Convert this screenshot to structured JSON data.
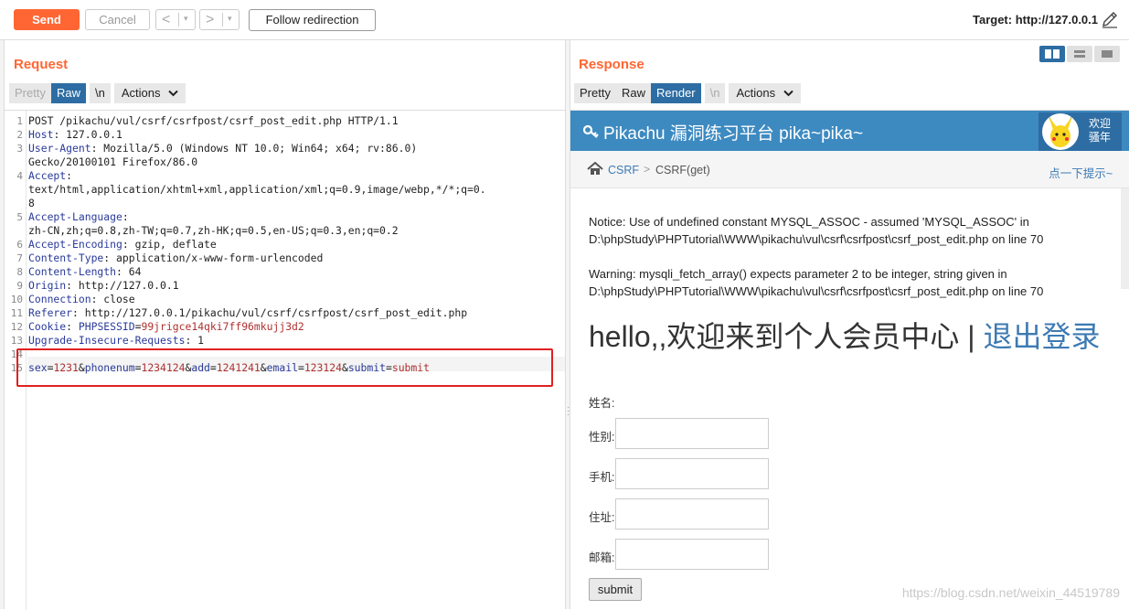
{
  "toolbar": {
    "send_label": "Send",
    "cancel_label": "Cancel",
    "back_arrow": "<",
    "forward_arrow": ">",
    "dropdown_arrow": "▾",
    "follow_label": "Follow redirection",
    "target_label": "Target: http://127.0.0.1"
  },
  "request": {
    "title": "Request",
    "tabs": {
      "pretty": "Pretty",
      "raw": "Raw",
      "newline": "\\n",
      "actions": "Actions"
    },
    "lines": [
      {
        "n": "1",
        "segments": [
          {
            "t": "POST /pikachu/vul/csrf/csrfpost/csrf_post_edit.php HTTP/1.1",
            "c": ""
          }
        ]
      },
      {
        "n": "2",
        "segments": [
          {
            "t": "Host",
            "c": "hdr"
          },
          {
            "t": ": 127.0.0.1",
            "c": ""
          }
        ]
      },
      {
        "n": "3",
        "segments": [
          {
            "t": "User-Agent",
            "c": "hdr"
          },
          {
            "t": ": Mozilla/5.0 (Windows NT 10.0; Win64; x64; rv:86.0)",
            "c": ""
          }
        ]
      },
      {
        "n": "",
        "segments": [
          {
            "t": "Gecko/20100101 Firefox/86.0",
            "c": ""
          }
        ]
      },
      {
        "n": "4",
        "segments": [
          {
            "t": "Accept",
            "c": "hdr"
          },
          {
            "t": ":",
            "c": ""
          }
        ]
      },
      {
        "n": "",
        "segments": [
          {
            "t": "text/html,application/xhtml+xml,application/xml;q=0.9,image/webp,*/*;q=0.",
            "c": ""
          }
        ]
      },
      {
        "n": "",
        "segments": [
          {
            "t": "8",
            "c": ""
          }
        ]
      },
      {
        "n": "5",
        "segments": [
          {
            "t": "Accept-Language",
            "c": "hdr"
          },
          {
            "t": ":",
            "c": ""
          }
        ]
      },
      {
        "n": "",
        "segments": [
          {
            "t": "zh-CN,zh;q=0.8,zh-TW;q=0.7,zh-HK;q=0.5,en-US;q=0.3,en;q=0.2",
            "c": ""
          }
        ]
      },
      {
        "n": "6",
        "segments": [
          {
            "t": "Accept-Encoding",
            "c": "hdr"
          },
          {
            "t": ": gzip, deflate",
            "c": ""
          }
        ]
      },
      {
        "n": "7",
        "segments": [
          {
            "t": "Content-Type",
            "c": "hdr"
          },
          {
            "t": ": application/x-www-form-urlencoded",
            "c": ""
          }
        ]
      },
      {
        "n": "8",
        "segments": [
          {
            "t": "Content-Length",
            "c": "hdr"
          },
          {
            "t": ": 64",
            "c": ""
          }
        ]
      },
      {
        "n": "9",
        "segments": [
          {
            "t": "Origin",
            "c": "hdr"
          },
          {
            "t": ": http://127.0.0.1",
            "c": ""
          }
        ]
      },
      {
        "n": "10",
        "segments": [
          {
            "t": "Connection",
            "c": "hdr"
          },
          {
            "t": ": close",
            "c": ""
          }
        ]
      },
      {
        "n": "11",
        "segments": [
          {
            "t": "Referer",
            "c": "hdr"
          },
          {
            "t": ": http://127.0.0.1/pikachu/vul/csrf/csrfpost/csrf_post_edit.php",
            "c": ""
          }
        ]
      },
      {
        "n": "12",
        "segments": [
          {
            "t": "Cookie",
            "c": "hdr"
          },
          {
            "t": ": ",
            "c": ""
          },
          {
            "t": "PHPSESSID",
            "c": "hdr"
          },
          {
            "t": "=",
            "c": ""
          },
          {
            "t": "99jrigce14qki7ff96mkujj3d2",
            "c": "val"
          }
        ]
      },
      {
        "n": "13",
        "segments": [
          {
            "t": "Upgrade-Insecure-Requests",
            "c": "hdr"
          },
          {
            "t": ": 1",
            "c": ""
          }
        ]
      },
      {
        "n": "14",
        "segments": []
      },
      {
        "n": "15",
        "segments": [
          {
            "t": "sex",
            "c": "hdr"
          },
          {
            "t": "=",
            "c": ""
          },
          {
            "t": "1231",
            "c": "val"
          },
          {
            "t": "&",
            "c": ""
          },
          {
            "t": "phonenum",
            "c": "hdr"
          },
          {
            "t": "=",
            "c": ""
          },
          {
            "t": "1234124",
            "c": "val"
          },
          {
            "t": "&",
            "c": ""
          },
          {
            "t": "add",
            "c": "hdr"
          },
          {
            "t": "=",
            "c": ""
          },
          {
            "t": "1241241",
            "c": "val"
          },
          {
            "t": "&",
            "c": ""
          },
          {
            "t": "email",
            "c": "hdr"
          },
          {
            "t": "=",
            "c": ""
          },
          {
            "t": "123124",
            "c": "val"
          },
          {
            "t": "&",
            "c": ""
          },
          {
            "t": "submit",
            "c": "hdr"
          },
          {
            "t": "=",
            "c": ""
          },
          {
            "t": "submit",
            "c": "val"
          }
        ]
      }
    ]
  },
  "response": {
    "title": "Response",
    "tabs": {
      "pretty": "Pretty",
      "raw": "Raw",
      "render": "Render",
      "newline": "\\n",
      "actions": "Actions"
    },
    "page": {
      "site_title": "Pikachu 漏洞练习平台 pika~pika~",
      "welcome_line1": "欢迎",
      "welcome_line2": "骚年",
      "crumb_link": "CSRF",
      "crumb_sep": ">",
      "crumb_current": "CSRF(get)",
      "hint": "点一下提示~",
      "notice_label": "Notice",
      "notice_text": ": Use of undefined constant MYSQL_ASSOC - assumed 'MYSQL_ASSOC' in",
      "notice_path": "D:\\phpStudy\\PHPTutorial\\WWW\\pikachu\\vul\\csrf\\csrfpost\\csrf_post_edit.php",
      "notice_online": " on line ",
      "notice_lineno": "70",
      "warning_label": "Warning",
      "warning_text": ": mysqli_fetch_array() expects parameter 2 to be integer, string given in",
      "warning_path": "D:\\phpStudy\\PHPTutorial\\WWW\\pikachu\\vul\\csrf\\csrfpost\\csrf_post_edit.php",
      "warning_online": " on line ",
      "warning_lineno": "70",
      "hello_text": "hello,,欢迎来到个人会员中心 | ",
      "logout_text": "退出登录",
      "name_label": "姓名:",
      "fields": [
        {
          "label": "性别:"
        },
        {
          "label": "手机:"
        },
        {
          "label": "住址:"
        },
        {
          "label": "邮箱:"
        }
      ],
      "submit_label": "submit",
      "watermark": "https://blog.csdn.net/weixin_44519789"
    }
  },
  "colors": {
    "accent": "#ff6633",
    "tab_active": "#2d6da3",
    "pikachu_header": "#3d8ac1",
    "highlight": "#e02020"
  }
}
